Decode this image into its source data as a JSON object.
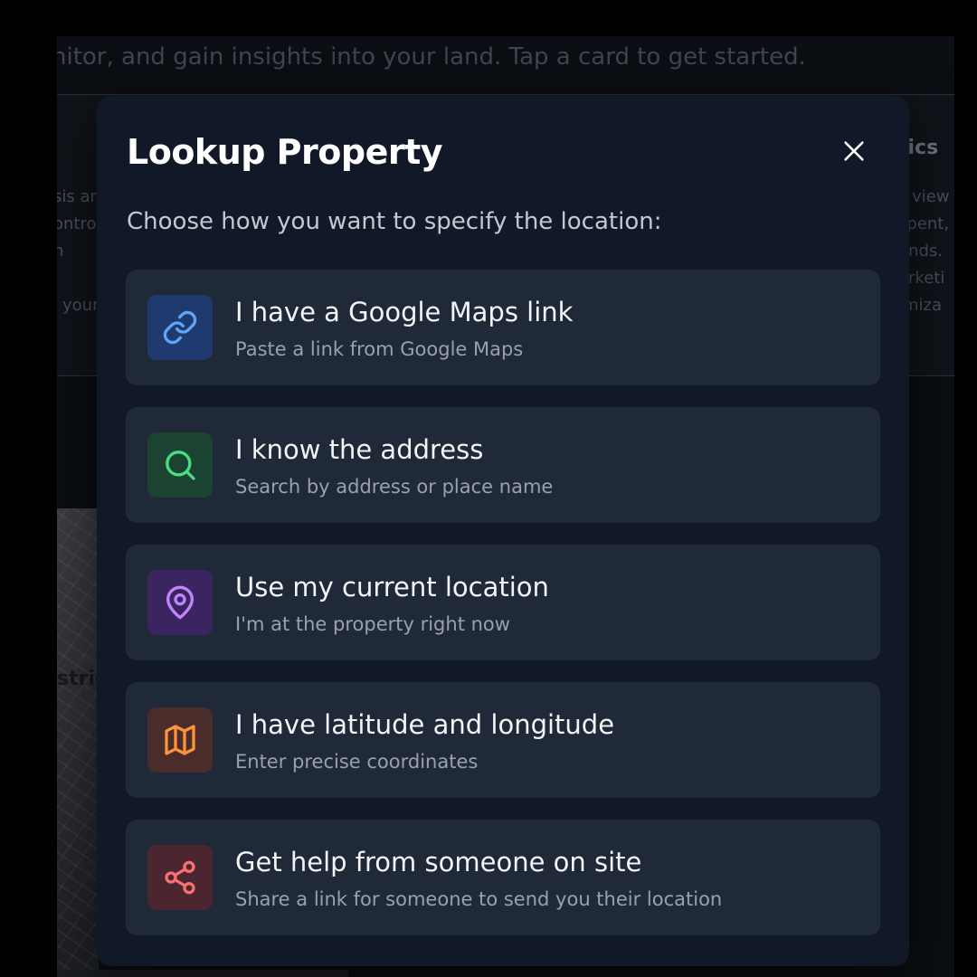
{
  "background": {
    "intro_text": "nitor, and gain insights into your land. Tap a card to get started.",
    "left_card": {
      "lines": [
        "sis an",
        "ontro",
        "h",
        "your"
      ]
    },
    "right_card": {
      "title": "tics",
      "lines": [
        "s view",
        "spent,",
        "ends.",
        "arketi",
        "imiza"
      ]
    },
    "map_label": "stric"
  },
  "modal": {
    "title": "Lookup Property",
    "close_icon": "close-icon",
    "subtitle": "Choose how you want to specify the location:",
    "options": [
      {
        "title": "I have a Google Maps link",
        "description": "Paste a link from Google Maps",
        "icon": "link-icon",
        "accent": "#60a5fa",
        "icon_bg": "#1e3a6e"
      },
      {
        "title": "I know the address",
        "description": "Search by address or place name",
        "icon": "search-icon",
        "accent": "#4ade80",
        "icon_bg": "#1b4332"
      },
      {
        "title": "Use my current location",
        "description": "I'm at the property right now",
        "icon": "map-pin-icon",
        "accent": "#c084fc",
        "icon_bg": "#3b2560"
      },
      {
        "title": "I have latitude and longitude",
        "description": "Enter precise coordinates",
        "icon": "map-icon",
        "accent": "#fb923c",
        "icon_bg": "#4a2c2a"
      },
      {
        "title": "Get help from someone on site",
        "description": "Share a link for someone to send you their location",
        "icon": "share-icon",
        "accent": "#f87171",
        "icon_bg": "#4b2530"
      }
    ]
  }
}
